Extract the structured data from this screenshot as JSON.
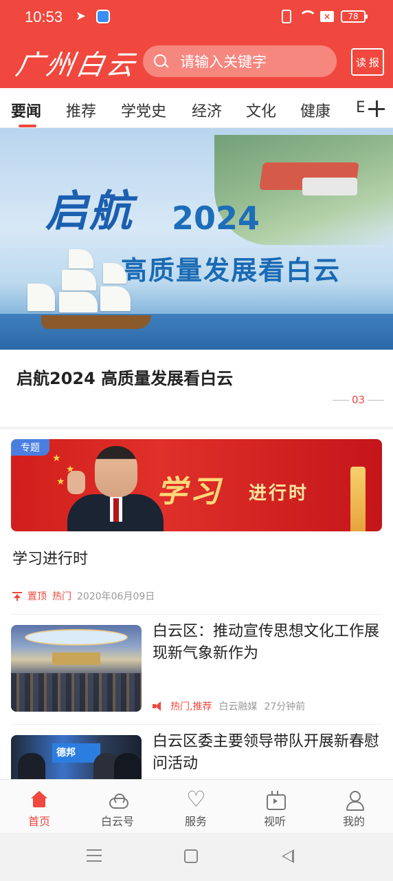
{
  "status_bar": {
    "time": "10:53",
    "battery": "78",
    "notification_icons": [
      "telegram-icon",
      "app-icon"
    ],
    "system_icons": [
      "vibrate-icon",
      "wifi-icon",
      "sim-icon",
      "battery-icon"
    ]
  },
  "header": {
    "logo_text": "广州白云",
    "search_placeholder": "请输入关键字",
    "read_paper_chars": [
      "读",
      "报"
    ],
    "accent_color": "#f0483e"
  },
  "tabs": {
    "items": [
      "要闻",
      "推荐",
      "学党史",
      "经济",
      "文化",
      "健康"
    ],
    "partial": "E",
    "active": "要闻"
  },
  "banner": {
    "title_big": "启航",
    "year": "2024",
    "subtitle": "高质量发展看白云",
    "caption": "启航2024 高质量发展看白云",
    "page_indicator": "03"
  },
  "topic": {
    "tag": "专题",
    "image_title_big": "学习",
    "image_title_small": "进行时",
    "heading": "学习进行时",
    "meta": {
      "pinned": "置顶",
      "hot": "热门",
      "date": "2020年06月09日"
    }
  },
  "news": [
    {
      "title": "白云区：推动宣传思想文化工作展现新气象新作为",
      "tags": "热门,推荐",
      "source": "白云融媒",
      "time": "27分钟前"
    },
    {
      "title": "白云区委主要领导带队开展新春慰问活动",
      "thumb_sign": "德邦"
    }
  ],
  "bottom_nav": {
    "items": [
      "首页",
      "白云号",
      "服务",
      "视听",
      "我的"
    ],
    "active": "首页"
  }
}
